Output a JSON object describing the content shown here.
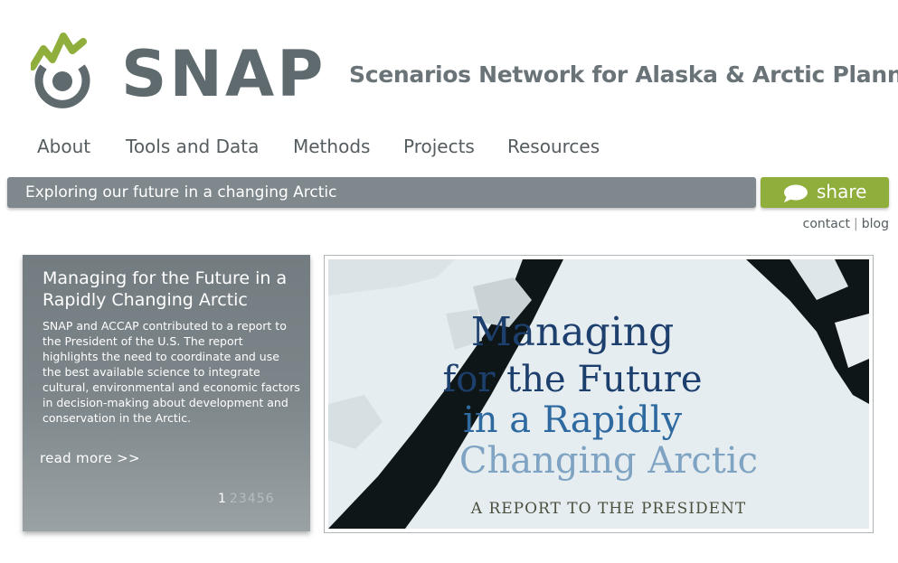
{
  "brand": {
    "logo_text": "SNAP",
    "tagline": "Scenarios Network for Alaska & Arctic Planning",
    "colors": {
      "green": "#8fae3c",
      "gray": "#5e6a6e",
      "bar": "#7f888c"
    }
  },
  "nav": {
    "items": [
      {
        "label": "About"
      },
      {
        "label": "Tools and Data"
      },
      {
        "label": "Methods"
      },
      {
        "label": "Projects"
      },
      {
        "label": "Resources"
      }
    ]
  },
  "banner": {
    "text": "Exploring our future in a changing Arctic"
  },
  "share": {
    "label": "share",
    "icon": "speech-bubble-icon"
  },
  "util_links": {
    "contact": "contact",
    "separator": "|",
    "blog": "blog"
  },
  "feature_panel": {
    "title": "Managing for the Future in a Rapidly Changing Arctic",
    "body": "SNAP and ACCAP contributed to a report to the President of the U.S. The report highlights the need to coordinate and use the best available science to integrate cultural, environmental and economic factors in decision-making about development and conservation in the Arctic.",
    "read_more": "read more >>",
    "pages": [
      "1",
      "2",
      "3",
      "4",
      "5",
      "6"
    ],
    "active_page": "1"
  },
  "feature_image": {
    "line1": "Managing",
    "line2": "for the Future",
    "line3": "in a Rapidly",
    "line4": "Changing Arctic",
    "line5": "A REPORT TO THE PRESIDENT"
  }
}
